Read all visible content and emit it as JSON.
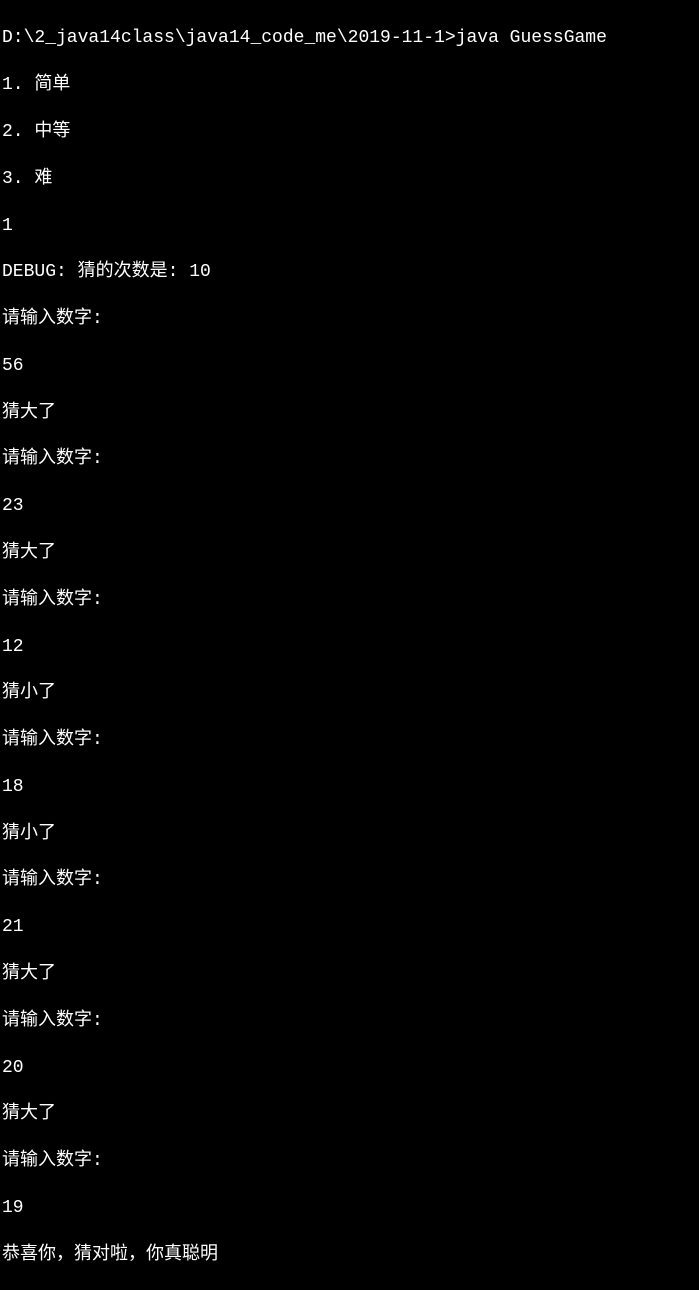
{
  "terminal": {
    "prompt_line": "D:\\2_java14class\\java14_code_me\\2019-11-1>java GuessGame",
    "menu": {
      "option1": "1. 简单",
      "option2": "2. 中等",
      "option3": "3. 难"
    },
    "user_choice": "1",
    "debug_line": "DEBUG: 猜的次数是: 10",
    "prompt_input": "请输入数字:",
    "feedback_too_big": "猜大了",
    "feedback_too_small": "猜小了",
    "guesses": {
      "g1": "56",
      "g2": "23",
      "g3": "12",
      "g4": "18",
      "g5": "21",
      "g6": "20",
      "g7": "19"
    },
    "success_message": "恭喜你，猜对啦，你真聪明"
  }
}
